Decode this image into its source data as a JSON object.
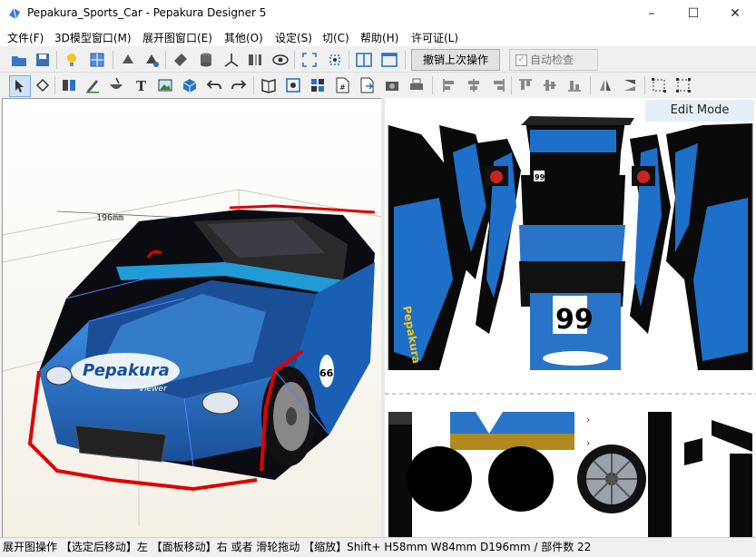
{
  "window": {
    "title": "Pepakura_Sports_Car - Pepakura Designer 5",
    "minimize": "–",
    "maximize": "☐",
    "close": "✕"
  },
  "menu": [
    "文件(F)",
    "3D模型窗口(M)",
    "展开图窗口(E)",
    "其他(O)",
    "设定(S)",
    "切(C)",
    "帮助(H)",
    "许可证(L)"
  ],
  "toolbar1": {
    "undo_label": "撤销上次操作",
    "auto_check_label": "自动检查",
    "auto_check_checked": true,
    "icons": [
      "open-icon",
      "save-icon",
      "lightbulb-icon",
      "texture-icon",
      "rotate-part-icon",
      "select-part-icon",
      "paint-icon",
      "cylinder-icon",
      "axis-icon",
      "split-view-icon",
      "eye-icon",
      "fit-icon",
      "settings-icon",
      "two-panes-icon",
      "single-pane-icon"
    ]
  },
  "toolbar2": {
    "icons": [
      "select-edit-icon",
      "rotate-edit-icon",
      "join-icon",
      "pen-icon",
      "bowl-icon",
      "text-icon",
      "image-icon",
      "box-icon",
      "undo-arrow-icon",
      "redo-arrow-icon",
      "book-icon",
      "zoom-icon",
      "grid-icon",
      "page-icon",
      "export-icon",
      "camera-icon",
      "print-icon",
      "align-left-icon",
      "align-center-icon",
      "align-right-icon",
      "align-top-icon",
      "align-middle-icon",
      "align-bottom-icon",
      "flip-h-icon",
      "flip-v-icon",
      "fit-width-icon",
      "fit-all-icon"
    ]
  },
  "view3d": {
    "dimension_label": "196mm",
    "car_number": "66",
    "logo_text": "Pepakura",
    "logo_sub": "Viewer"
  },
  "view2d": {
    "edit_mode_label": "Edit Mode",
    "number_label": "99",
    "hood_number": "99",
    "decal_text": "Pepakura"
  },
  "statusbar": {
    "text": "展开图操作 【选定后移动】左 【面板移动】右 或者 滑轮拖动 【缩放】Shift+ H58mm W84mm D196mm / 部件数 22"
  },
  "colors": {
    "accent_blue": "#1e6fc8",
    "car_black": "#111111",
    "cut_red": "#e00000"
  }
}
